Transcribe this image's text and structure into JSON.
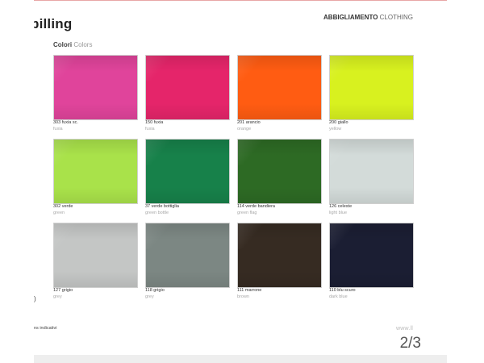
{
  "header": {
    "title": "billing",
    "section_bold": "ABBIGLIAMENTO",
    "section_light": "CLOTHING"
  },
  "colors_heading": {
    "it": "Colori",
    "en": "Colors"
  },
  "swatches": [
    {
      "code": "303 fuxia sc.",
      "name": "fuxia",
      "color": "#e0449b"
    },
    {
      "code": "150 fuxia",
      "name": "fuxia",
      "color": "#e5256a"
    },
    {
      "code": "201 arancio",
      "name": "orange",
      "color": "#ff5c12"
    },
    {
      "code": "200 giallo",
      "name": "yellow",
      "color": "#d8f11f"
    },
    {
      "code": "302 verde",
      "name": "green",
      "color": "#a9e24a"
    },
    {
      "code": "37 verde bottiglia",
      "name": "green bottle",
      "color": "#17814a"
    },
    {
      "code": "114 verde bandiera",
      "name": "green flag",
      "color": "#2d6a24"
    },
    {
      "code": "126 celeste",
      "name": "light blue",
      "color": "#d3dbd9"
    },
    {
      "code": "127 grigio",
      "name": "grey",
      "color": "#c4c6c5"
    },
    {
      "code": "118 grigio",
      "name": "grey",
      "color": "#7c8783"
    },
    {
      "code": "111 marrone",
      "name": "brown",
      "color": "#362b22"
    },
    {
      "code": "110 blu scuro",
      "name": "dark blue",
      "color": "#1b1e33"
    }
  ],
  "left_mark": ")",
  "footnote": "ns indicativi",
  "site": "www.ll",
  "page_number": "2/3"
}
